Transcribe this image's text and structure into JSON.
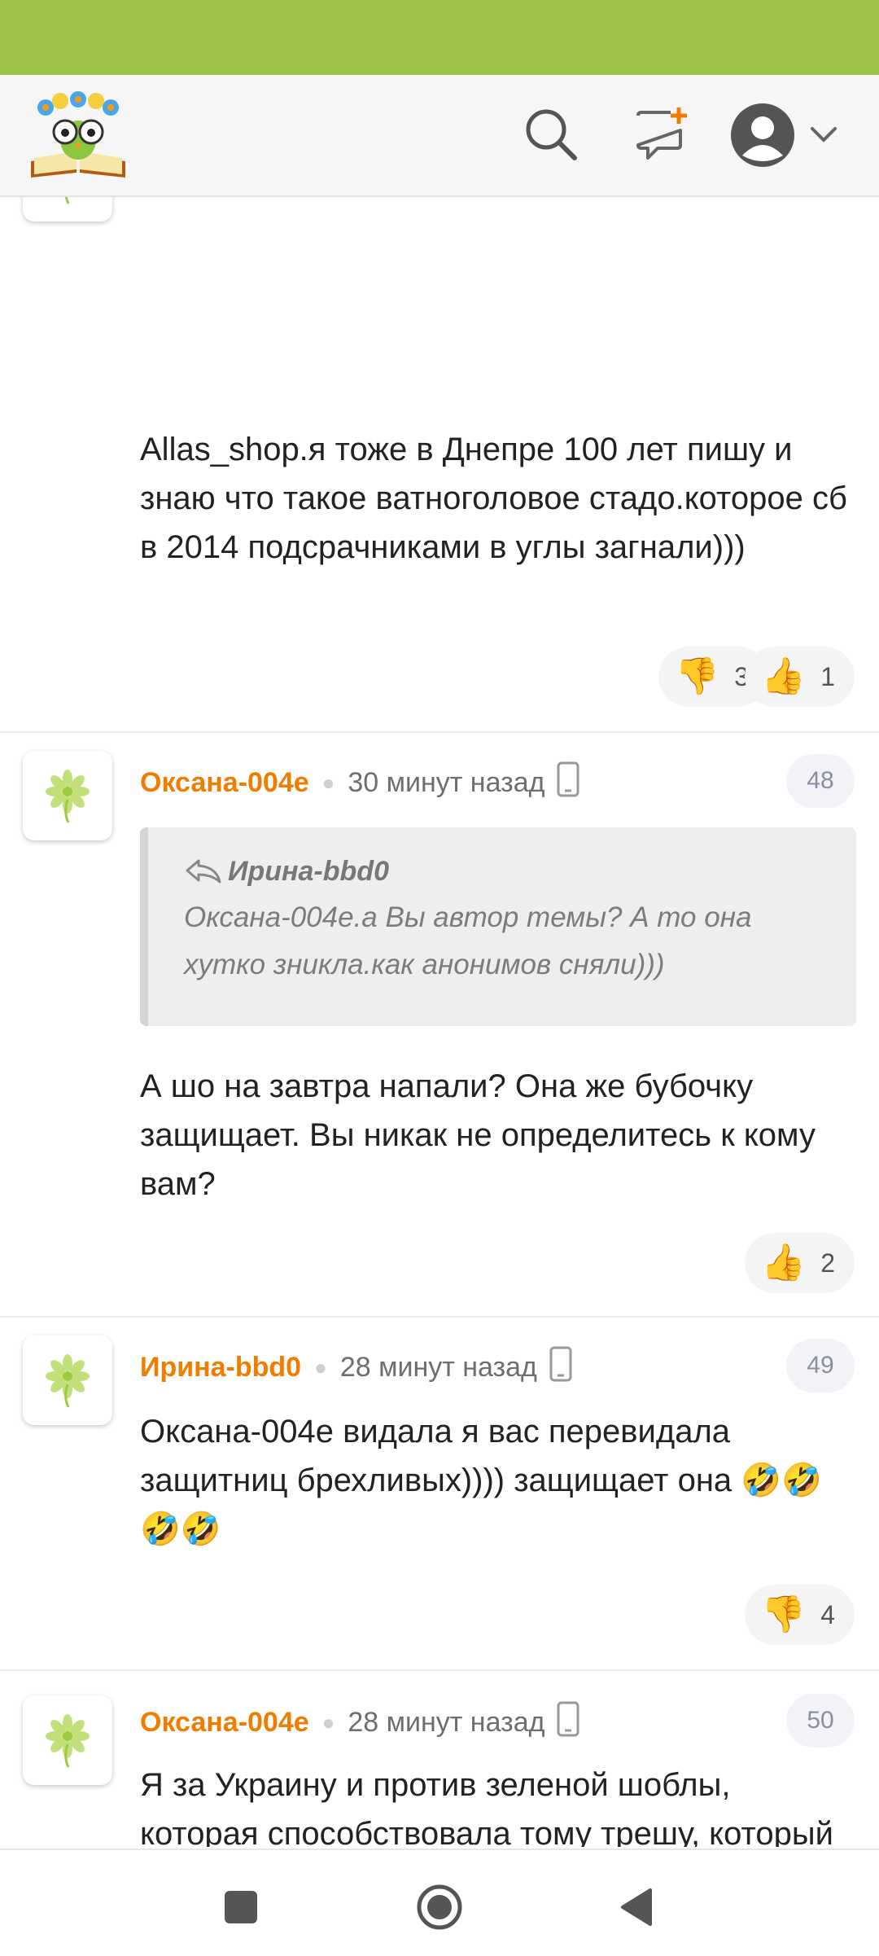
{
  "colors": {
    "status_bar": "#9ec245",
    "author": "#f07c00",
    "header_bg": "#f6f6f6"
  },
  "header": {
    "logo": "book-flower-owl-logo",
    "search_icon": "search-icon",
    "new_message_icon": "new-message-icon",
    "profile_icon": "user-avatar-icon"
  },
  "comments": [
    {
      "text": "Allas_shop.я тоже в Днепре 100 лет пишу и знаю что такое ватноголовое стадо.которое сб в 2014 подсрачниками в углы загнали)))",
      "dislikes": "3",
      "likes": "1"
    },
    {
      "author": "Оксана-004е",
      "time": "30 минут назад",
      "number": "48",
      "quote_author": "Ирина-bbd0",
      "quote_text": "Оксана-004е.а Вы автор темы? А то она хутко зникла.как анонимов сняли)))",
      "text": "А шо на завтра напали? Она же бубочку защищает. Вы никак не определитесь к кому вам?",
      "likes": "2"
    },
    {
      "author": "Ирина-bbd0",
      "time": "28 минут назад",
      "number": "49",
      "text": "Оксана-004е видала я вас перевидала защитниц брехливых)))) защищает она 🤣🤣🤣🤣",
      "dislikes": "4"
    },
    {
      "author": "Оксана-004е",
      "time": "28 минут назад",
      "number": "50",
      "text": "Я за Украину и против зеленой шоблы, которая способствовала тому трешу, который сейчас творится. Надеюсь если не человеческий трибунал, то Суд Божий бросят в один котёл зелень с пуйлом"
    }
  ],
  "navbar": {
    "recents": "square-icon",
    "home": "circle-icon",
    "back": "triangle-back-icon"
  }
}
